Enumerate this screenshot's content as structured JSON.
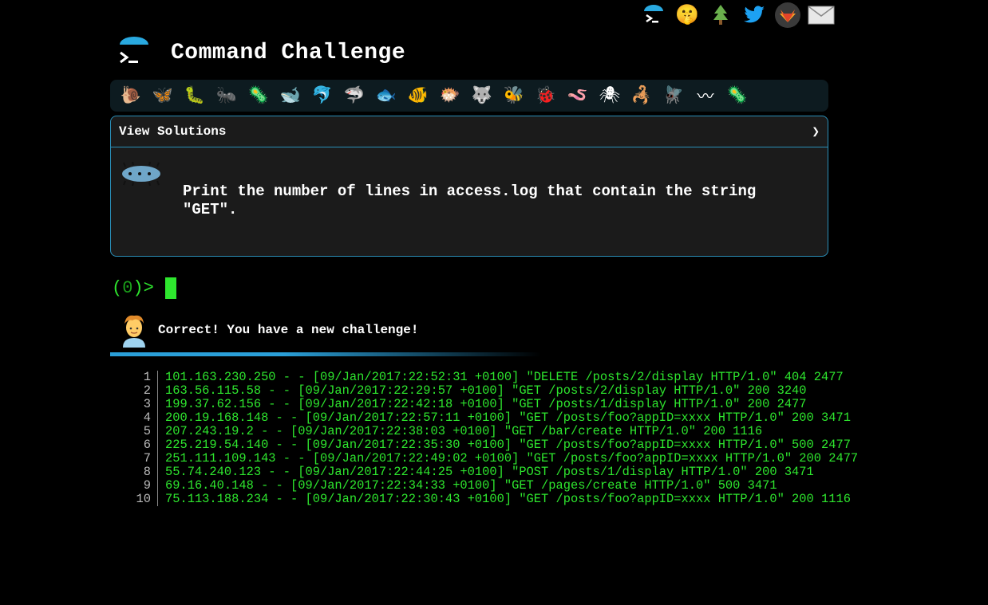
{
  "app": {
    "title": "Command Challenge"
  },
  "social_icons": [
    "terminal-logo-icon",
    "shushing-face-icon",
    "tree-icon",
    "twitter-icon",
    "gitlab-icon",
    "mail-icon"
  ],
  "critters": [
    {
      "name": "snail-icon",
      "glyph": "🐌"
    },
    {
      "name": "butterfly-icon",
      "glyph": "🦋"
    },
    {
      "name": "caterpillar-icon",
      "glyph": "🐛"
    },
    {
      "name": "ant-icon",
      "glyph": "🐜"
    },
    {
      "name": "microbe-icon",
      "glyph": "🦠"
    },
    {
      "name": "whale-icon",
      "glyph": "🐋"
    },
    {
      "name": "dolphin-icon",
      "glyph": "🐬"
    },
    {
      "name": "shark-icon",
      "glyph": "🦈"
    },
    {
      "name": "fish-icon",
      "glyph": "🐟"
    },
    {
      "name": "tropical-fish-icon",
      "glyph": "🐠"
    },
    {
      "name": "blowfish-icon",
      "glyph": "🐡"
    },
    {
      "name": "wolf-icon",
      "glyph": "🐺"
    },
    {
      "name": "bee-icon",
      "glyph": "🐝"
    },
    {
      "name": "ladybug-icon",
      "glyph": "🐞"
    },
    {
      "name": "worm-icon",
      "glyph": "🪱"
    },
    {
      "name": "spider-icon",
      "glyph": "🕷"
    },
    {
      "name": "scorpion-icon",
      "glyph": "🦂"
    },
    {
      "name": "fly-icon",
      "glyph": "🪰"
    },
    {
      "name": "earthworm-icon",
      "glyph": "〰"
    },
    {
      "name": "tardigrade-icon",
      "glyph": "🦠"
    }
  ],
  "panel": {
    "header_label": "View Solutions",
    "chevron": "❯",
    "challenge_text": "Print the number of lines in access.log that contain the string \"GET\"."
  },
  "prompt": {
    "open": "(",
    "count": "0",
    "close": ")>"
  },
  "feedback": {
    "message": "Correct! You have a new challenge!"
  },
  "log": {
    "lines": [
      {
        "n": "1",
        "text": "101.163.230.250 - - [09/Jan/2017:22:52:31 +0100] \"DELETE /posts/2/display HTTP/1.0\" 404 2477"
      },
      {
        "n": "2",
        "text": "163.56.115.58 - - [09/Jan/2017:22:29:57 +0100] \"GET /posts/2/display HTTP/1.0\" 200 3240"
      },
      {
        "n": "3",
        "text": "199.37.62.156 - - [09/Jan/2017:22:42:18 +0100] \"GET /posts/1/display HTTP/1.0\" 200 2477"
      },
      {
        "n": "4",
        "text": "200.19.168.148 - - [09/Jan/2017:22:57:11 +0100] \"GET /posts/foo?appID=xxxx HTTP/1.0\" 200 3471"
      },
      {
        "n": "5",
        "text": "207.243.19.2 - - [09/Jan/2017:22:38:03 +0100] \"GET /bar/create HTTP/1.0\" 200 1116"
      },
      {
        "n": "6",
        "text": "225.219.54.140 - - [09/Jan/2017:22:35:30 +0100] \"GET /posts/foo?appID=xxxx HTTP/1.0\" 500 2477"
      },
      {
        "n": "7",
        "text": "251.111.109.143 - - [09/Jan/2017:22:49:02 +0100] \"GET /posts/foo?appID=xxxx HTTP/1.0\" 200 2477"
      },
      {
        "n": "8",
        "text": "55.74.240.123 - - [09/Jan/2017:22:44:25 +0100] \"POST /posts/1/display HTTP/1.0\" 200 3471"
      },
      {
        "n": "9",
        "text": "69.16.40.148 - - [09/Jan/2017:22:34:33 +0100] \"GET /pages/create HTTP/1.0\" 500 3471"
      },
      {
        "n": "10",
        "text": "75.113.188.234 - - [09/Jan/2017:22:30:43 +0100] \"GET /posts/foo?appID=xxxx HTTP/1.0\" 200 1116"
      }
    ]
  },
  "colors": {
    "accent": "#2a8fb8",
    "terminal_green": "#2ee62e",
    "panel_bg": "#1b1b1b"
  }
}
